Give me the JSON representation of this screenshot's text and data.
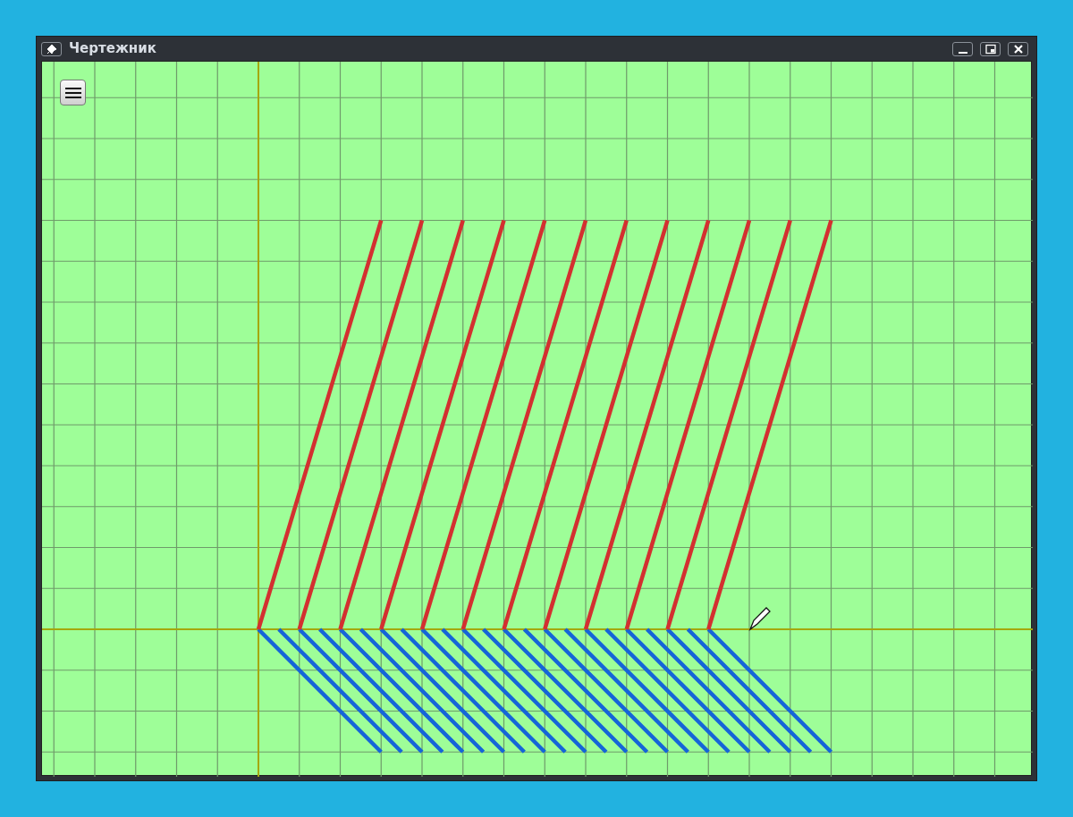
{
  "window": {
    "title": "Чертежник"
  }
}
